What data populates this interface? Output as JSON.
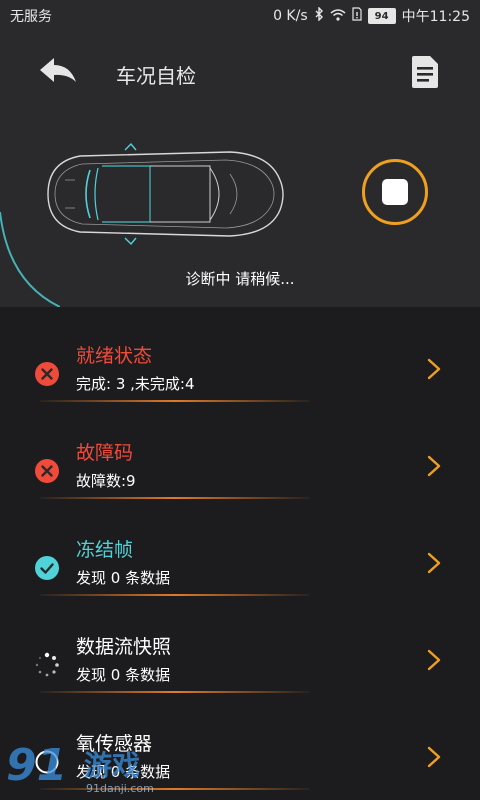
{
  "status_bar": {
    "carrier": "无服务",
    "speed": "0 K/s",
    "battery": "94",
    "time": "中午11:25"
  },
  "header": {
    "title": "车况自检",
    "diag_status": "诊断中 请稍候..."
  },
  "items": [
    {
      "title": "就绪状态",
      "sub": "完成: 3 ,未完成:4",
      "status": "error",
      "title_color": "#f04a3a"
    },
    {
      "title": "故障码",
      "sub": "故障数:9",
      "status": "error",
      "title_color": "#f04a3a"
    },
    {
      "title": "冻结帧",
      "sub": "发现 0 条数据",
      "status": "ok",
      "title_color": "#4fd3d9"
    },
    {
      "title": "数据流快照",
      "sub": "发现 0 条数据",
      "status": "loading",
      "title_color": "#ffffff"
    },
    {
      "title": "氧传感器",
      "sub": "发现 0 条数据",
      "status": "pending",
      "title_color": "#ffffff"
    }
  ],
  "colors": {
    "accent_orange": "#f0a020",
    "error_red": "#f04a3a",
    "ok_cyan": "#4fd3d9",
    "background": "#1c1c1e",
    "header_bg": "#2a2a2c"
  },
  "watermark": {
    "number": "91",
    "text": "游戏",
    "url": "91danji.com"
  }
}
